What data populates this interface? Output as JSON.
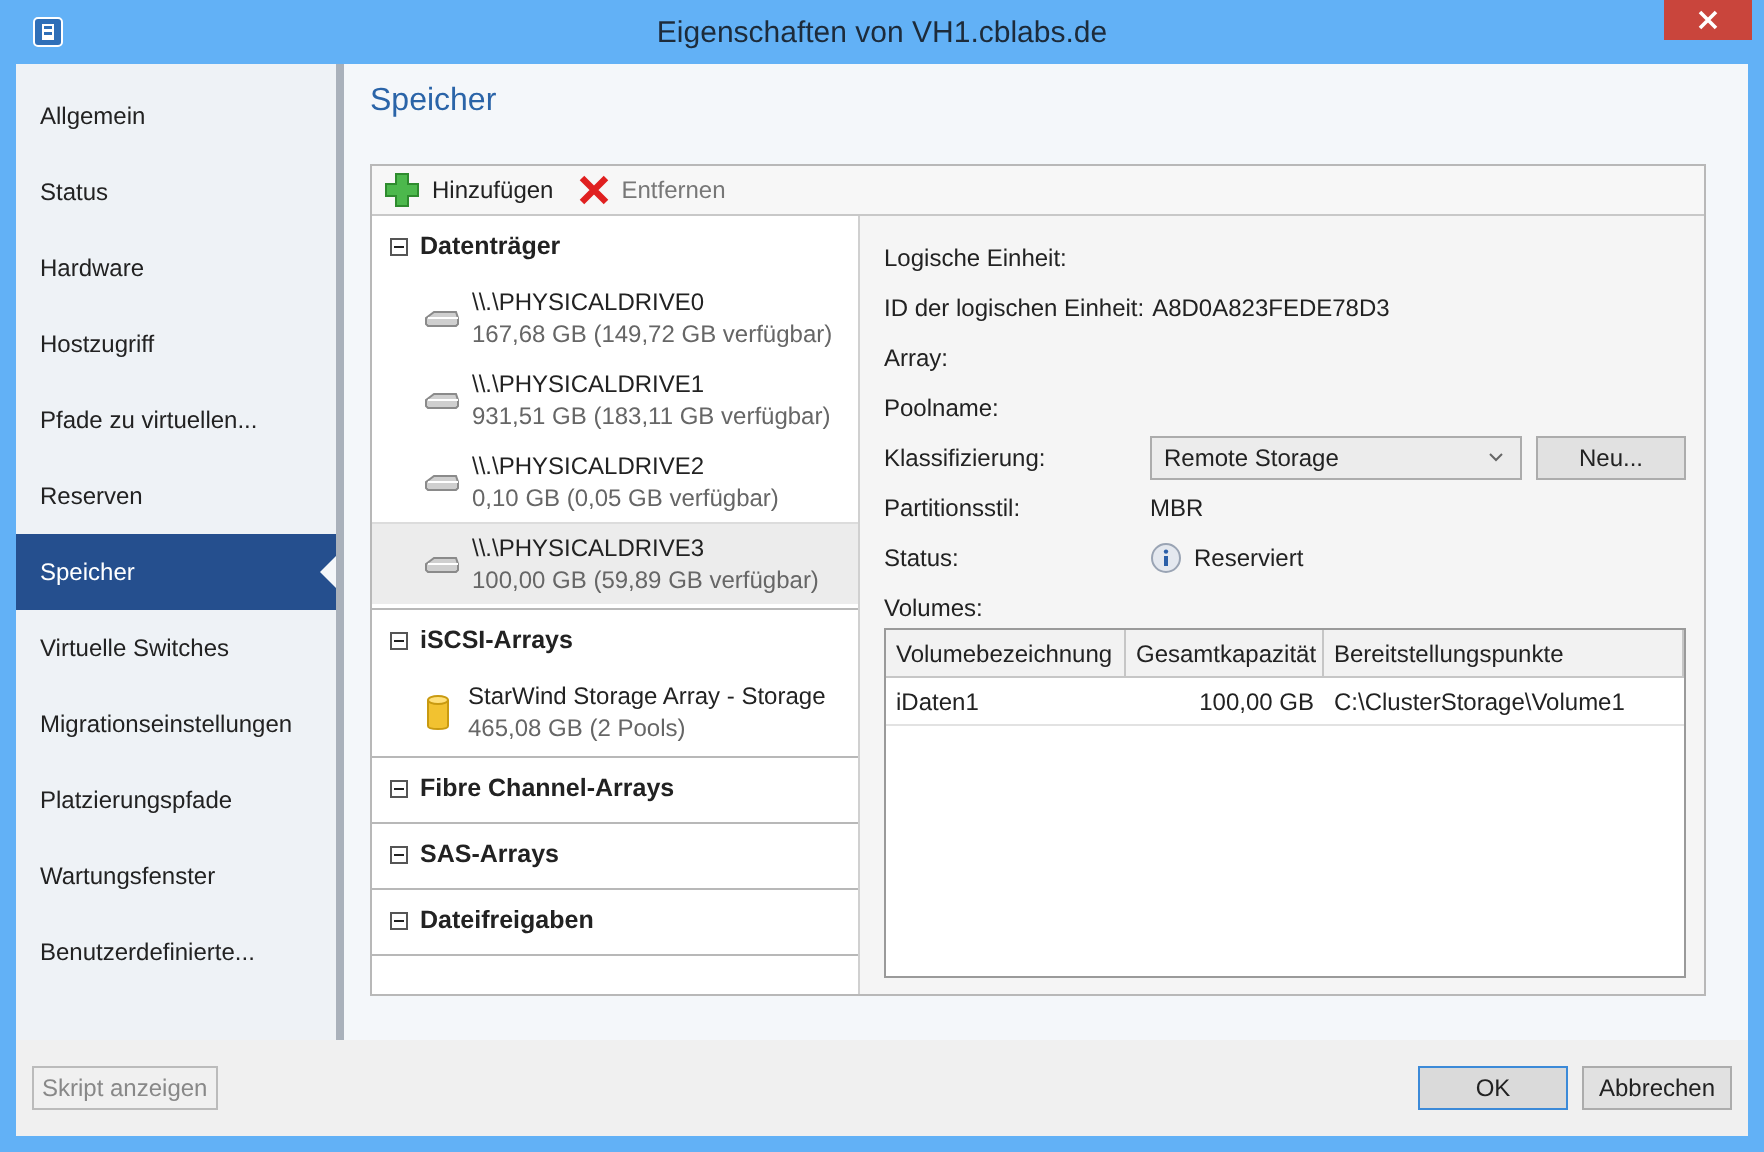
{
  "window": {
    "title": "Eigenschaften von VH1.cblabs.de"
  },
  "sidebar": {
    "items": [
      {
        "label": "Allgemein",
        "selected": false
      },
      {
        "label": "Status",
        "selected": false
      },
      {
        "label": "Hardware",
        "selected": false
      },
      {
        "label": "Hostzugriff",
        "selected": false
      },
      {
        "label": "Pfade zu virtuellen...",
        "selected": false
      },
      {
        "label": "Reserven",
        "selected": false
      },
      {
        "label": "Speicher",
        "selected": true
      },
      {
        "label": "Virtuelle Switches",
        "selected": false
      },
      {
        "label": "Migrationseinstellungen",
        "selected": false
      },
      {
        "label": "Platzierungspfade",
        "selected": false
      },
      {
        "label": "Wartungsfenster",
        "selected": false
      },
      {
        "label": "Benutzerdefinierte...",
        "selected": false
      }
    ]
  },
  "heading": "Speicher",
  "toolbar": [
    {
      "kind": "add",
      "label": "Hinzufügen",
      "disabled": false
    },
    {
      "kind": "remove",
      "label": "Entfernen",
      "disabled": true
    }
  ],
  "tree": [
    {
      "label": "Datenträger",
      "expanded": true,
      "children": [
        {
          "kind": "disk",
          "name": "\\\\.\\PHYSICALDRIVE0",
          "detail": "167,68 GB (149,72 GB verfügbar)",
          "selected": false
        },
        {
          "kind": "disk",
          "name": "\\\\.\\PHYSICALDRIVE1",
          "detail": "931,51 GB (183,11 GB verfügbar)",
          "selected": false
        },
        {
          "kind": "disk",
          "name": "\\\\.\\PHYSICALDRIVE2",
          "detail": "0,10 GB (0,05 GB verfügbar)",
          "selected": false
        },
        {
          "kind": "disk",
          "name": "\\\\.\\PHYSICALDRIVE3",
          "detail": "100,00 GB (59,89 GB verfügbar)",
          "selected": true
        }
      ]
    },
    {
      "label": "iSCSI-Arrays",
      "expanded": true,
      "children": [
        {
          "kind": "array",
          "name": "StarWind Storage Array - Storage",
          "detail": "465,08 GB (2 Pools)",
          "selected": false
        }
      ]
    },
    {
      "label": "Fibre Channel-Arrays",
      "expanded": true
    },
    {
      "label": "SAS-Arrays",
      "expanded": true
    },
    {
      "label": "Dateifreigaben",
      "expanded": true
    }
  ],
  "details": [
    {
      "kind": "text",
      "label": "Logische Einheit:"
    },
    {
      "kind": "inline",
      "label": "ID der logischen Einheit:",
      "value": "A8D0A823FEDE78D3"
    },
    {
      "kind": "text",
      "label": "Array:"
    },
    {
      "kind": "text",
      "label": "Poolname:"
    },
    {
      "kind": "dropdown",
      "label": "Klassifizierung:",
      "value": "Remote Storage",
      "button": "Neu..."
    },
    {
      "kind": "text",
      "label": "Partitionsstil:",
      "value": "MBR"
    },
    {
      "kind": "status",
      "label": "Status:",
      "value": "Reserviert"
    }
  ],
  "volumes": {
    "label": "Volumes:",
    "columns": [
      "Volumebezeichnung",
      "Gesamtkapazität",
      "Bereitstellungspunkte"
    ],
    "rows": [
      [
        "iDaten1",
        "100,00 GB",
        "C:\\ClusterStorage\\Volume1"
      ]
    ]
  },
  "footer": {
    "script_button": {
      "label": "Skript anzeigen",
      "disabled": true
    },
    "buttons": [
      {
        "label": "OK",
        "default": true
      },
      {
        "label": "Abbrechen",
        "default": false
      }
    ]
  }
}
